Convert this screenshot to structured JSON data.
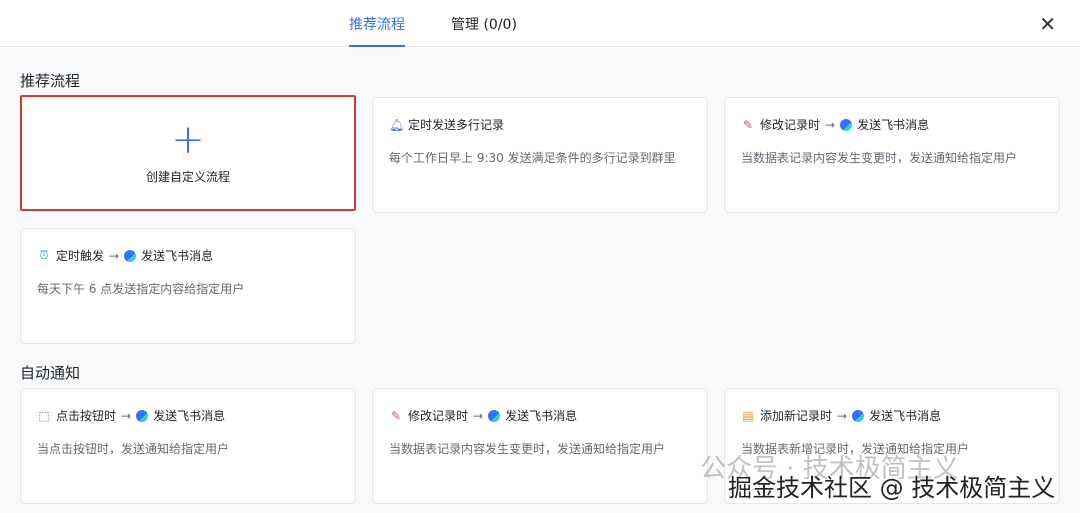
{
  "tabs": [
    {
      "label": "推荐流程"
    },
    {
      "label": "管理 (0/0)"
    }
  ],
  "sections": {
    "recommended": "推荐流程",
    "auto_notify": "自动通知"
  },
  "create": {
    "label": "创建自定义流程"
  },
  "cards": [
    {
      "icon": "bell-icon",
      "title": "定时发送多行记录",
      "desc": "每个工作日早上 9:30 发送满足条件的多行记录到群里"
    },
    {
      "icon": "pencil-icon",
      "title": "修改记录时",
      "action": "发送飞书消息",
      "desc": "当数据表记录内容发生变更时，发送通知给指定用户"
    },
    {
      "icon": "alarm-clock-icon",
      "title": "定时触发",
      "action": "发送飞书消息",
      "desc": "每天下午 6 点发送指定内容给指定用户"
    },
    {
      "icon": "click-button-icon",
      "title": "点击按钮时",
      "action": "发送飞书消息",
      "desc": "当点击按钮时，发送通知给指定用户"
    },
    {
      "icon": "pencil-icon",
      "title": "修改记录时",
      "action": "发送飞书消息",
      "desc": "当数据表记录内容发生变更时，发送通知给指定用户"
    },
    {
      "icon": "add-record-icon",
      "title": "添加新记录时",
      "action": "发送飞书消息",
      "desc": "当数据表新增记录时，发送通知给指定用户"
    }
  ],
  "arrow": "→",
  "watermark": {
    "line1": "公众号 · 技术极简主义",
    "line2": "掘金技术社区 @ 技术极简主义"
  }
}
